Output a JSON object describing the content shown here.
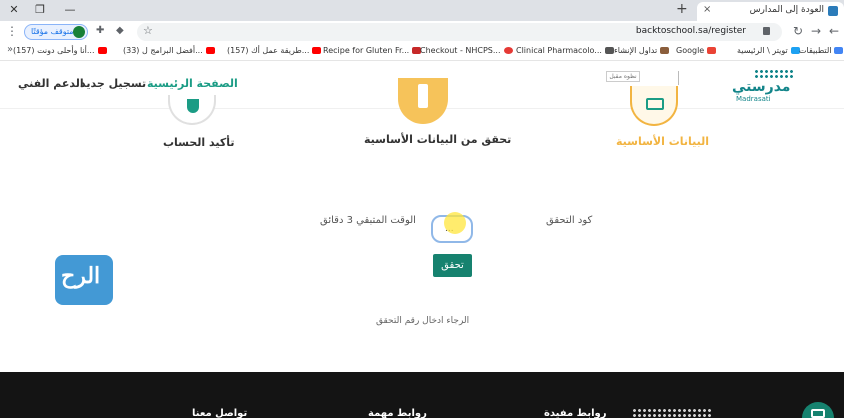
{
  "browser": {
    "tab_title": "العودة إلى المدارس",
    "url": "backtoschool.sa/register",
    "profile_label": "متوقف مؤقتًا",
    "new_tab": "+",
    "tab_close": "×",
    "win_minimize": "—",
    "win_restore": "❐",
    "win_close": "✕"
  },
  "bookmarks": [
    {
      "label": "التطبيقات",
      "color": "#4285f4"
    },
    {
      "label": "تويتر \\ الرئيسية",
      "color": "#1da1f2"
    },
    {
      "label": "Google",
      "color": "#ea4335"
    },
    {
      "label": "تداول الإنشاء",
      "color": "#8b5e3c"
    },
    {
      "label": "Clinical Pharmacolo...",
      "color": "#555555"
    },
    {
      "label": "Checkout - NHCPS...",
      "color": "#e53935"
    },
    {
      "label": "Recipe for Gluten Fr...",
      "color": "#c62828"
    },
    {
      "label": "(157) طريقة عمل أك...",
      "color": "#ff0000"
    },
    {
      "label": "(33) أفضل البرامج ل...",
      "color": "#ff0000"
    },
    {
      "label": "(157) أنا وأحلى دونت...",
      "color": "#ff0000"
    }
  ],
  "header": {
    "logo_ar": "مدرستي",
    "logo_en": "Madrasati",
    "tag": "نظوه مقبل",
    "nav": {
      "home": "الصفحة الرئيسية",
      "register": "تسجيل جديد",
      "support": "الدعم الفني"
    }
  },
  "steps": {
    "step1": "البيانات الأساسية",
    "step2": "تحقق من البيانات الأساسية",
    "step3": "تأكيد الحساب"
  },
  "form": {
    "code_label": "كود التحقق",
    "time_label": "الوقت المتبقي 3 دقائق",
    "code_value": "...",
    "verify_button": "تحقق",
    "hint": "الرجاء ادخال رقم التحقق"
  },
  "watermark": {
    "text": "الرح"
  },
  "footer": {
    "col1": "تواصل معنا",
    "col2": "روابط مهمة",
    "col3": "روابط مفيدة"
  },
  "colors": {
    "accent": "#16826f",
    "active_nav": "#1b9c85",
    "step_done": "#f2b441"
  }
}
